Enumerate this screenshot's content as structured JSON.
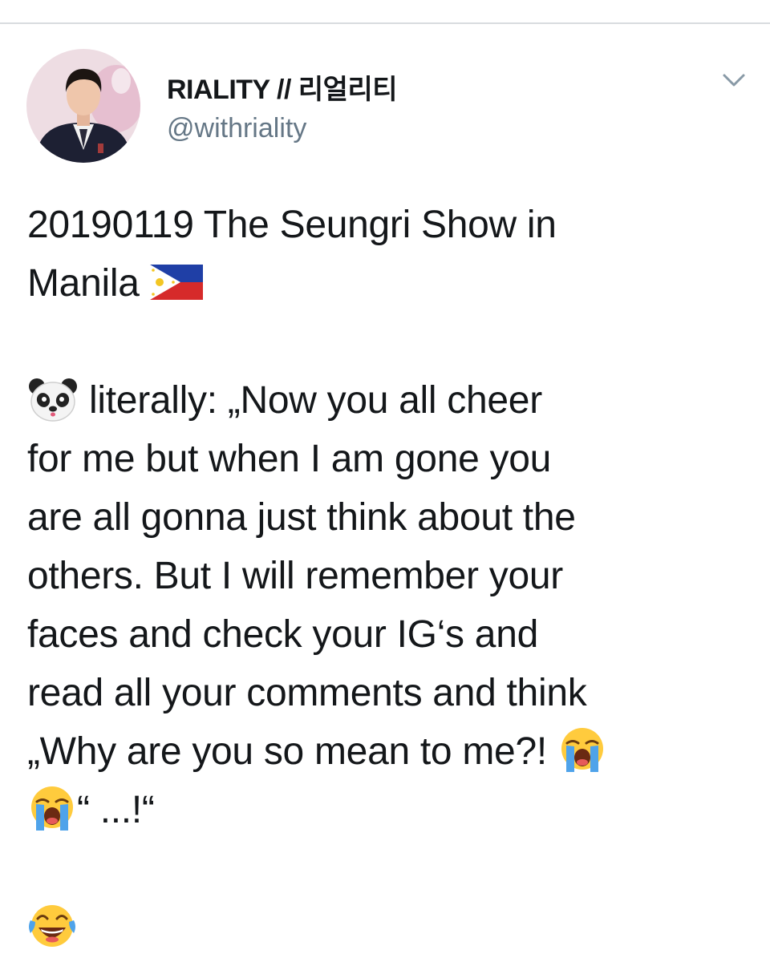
{
  "tweet": {
    "display_name": "RIALITY // 리얼리티",
    "handle": "@withriality",
    "lines": {
      "l1": "20190119 The Seungri Show in",
      "l2": "Manila",
      "l3": " literally: „Now you all cheer",
      "l4": "for me but when I am gone you",
      "l5": "are all gonna just think about the",
      "l6": "others. But I will remember your",
      "l7": "faces and check your IG‘s and",
      "l8": "read all your comments and think",
      "l9": "„Why are you so mean to me?! ",
      "l10": "“ ...!“"
    },
    "emojis": {
      "flag": "philippines-flag-emoji",
      "panda": "panda-face-emoji",
      "crying": "loudly-crying-face-emoji",
      "laughing": "face-with-tears-of-joy-emoji"
    }
  },
  "icons": {
    "menu": "chevron-down-icon",
    "avatar": "profile-avatar"
  },
  "colors": {
    "text": "#14171a",
    "secondary_text": "#657786",
    "divider": "#d9dcdf",
    "background": "#ffffff"
  }
}
